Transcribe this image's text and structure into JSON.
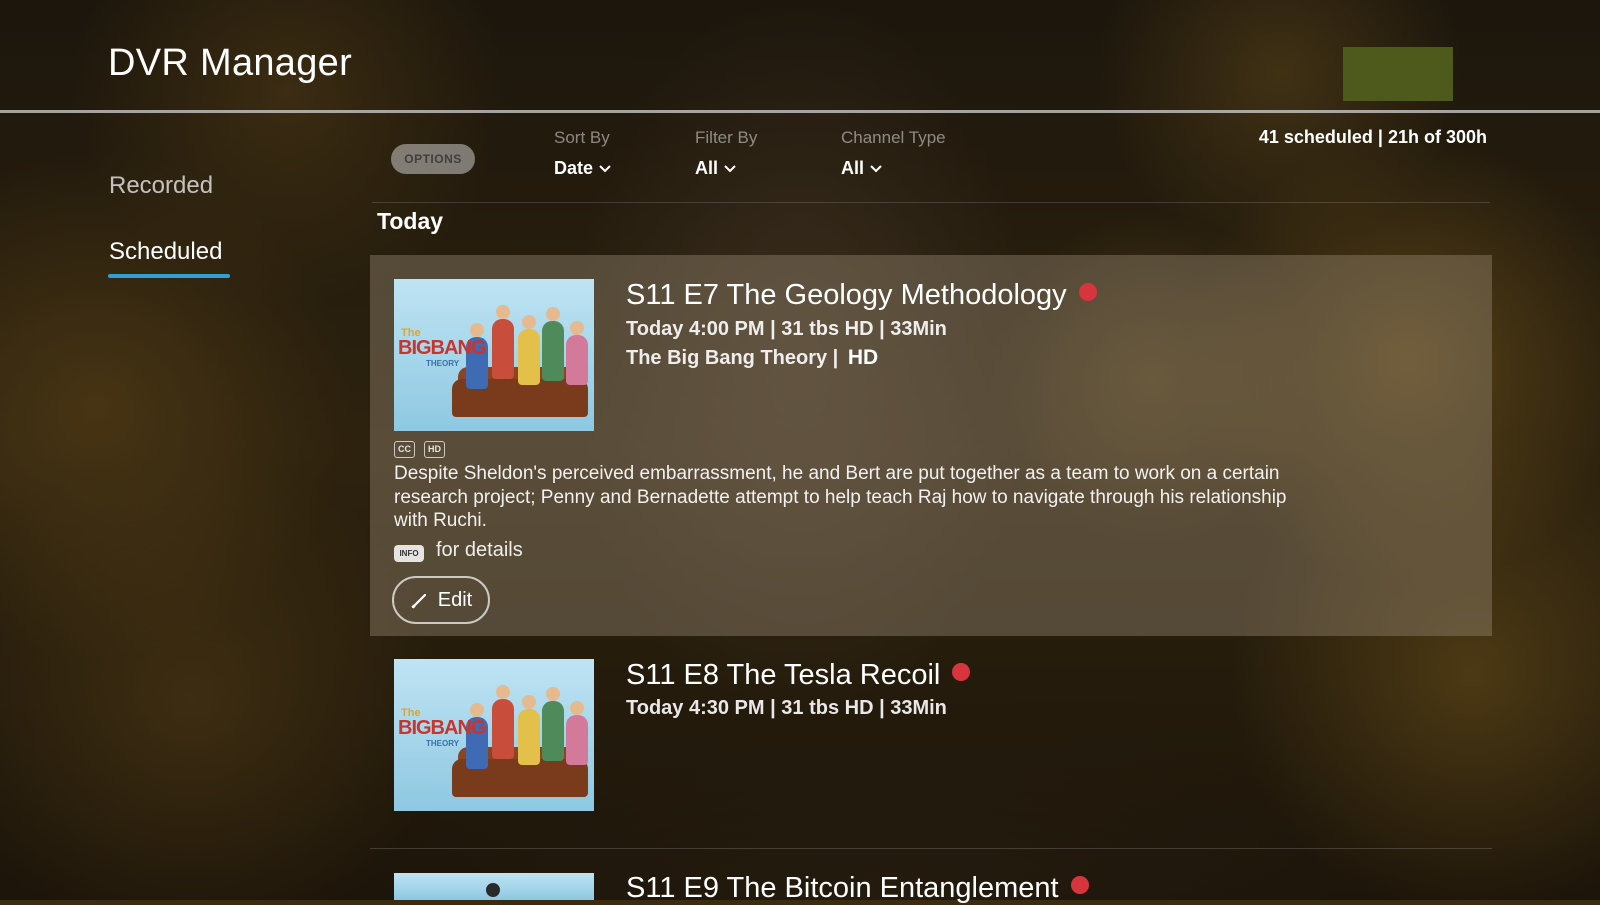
{
  "header": {
    "title": "DVR Manager"
  },
  "sidebar": {
    "items": [
      {
        "label": "Recorded"
      },
      {
        "label": "Scheduled",
        "selected": true
      }
    ],
    "accent_color": "#2f9fd6"
  },
  "options": {
    "button_label": "OPTIONS",
    "sort_by": {
      "label": "Sort By",
      "value": "Date"
    },
    "filter_by": {
      "label": "Filter By",
      "value": "All"
    },
    "channel_type": {
      "label": "Channel Type",
      "value": "All"
    },
    "storage_summary": "41 scheduled | 21h of 300h"
  },
  "section": {
    "title": "Today"
  },
  "recordings": [
    {
      "title": "S11 E7 The Geology Methodology",
      "meta": "Today 4:00 PM | 31 tbs HD | 33Min",
      "series": "The Big Bang Theory |",
      "quality": "HD",
      "badges": [
        "CC",
        "HD"
      ],
      "description": "Despite Sheldon's perceived embarrassment, he and Bert are put together as a team to work on a certain research project; Penny and Bernadette attempt to help teach Raj how to navigate through his relationship with Ruchi.",
      "info_key": "INFO",
      "info_text": "for details",
      "edit_label": "Edit",
      "thumbnail": {
        "logo_top": "The",
        "logo_main": "BIGBANG",
        "logo_bottom": "THEORY"
      }
    },
    {
      "title": "S11 E8 The Tesla Recoil",
      "meta": "Today 4:30 PM | 31 tbs HD | 33Min",
      "thumbnail": {
        "logo_top": "The",
        "logo_main": "BIGBANG",
        "logo_bottom": "THEORY"
      }
    },
    {
      "title": "S11 E9 The Bitcoin Entanglement"
    }
  ],
  "colors": {
    "record_dot": "#d8343d",
    "header_accent": "#4d5a1c"
  }
}
